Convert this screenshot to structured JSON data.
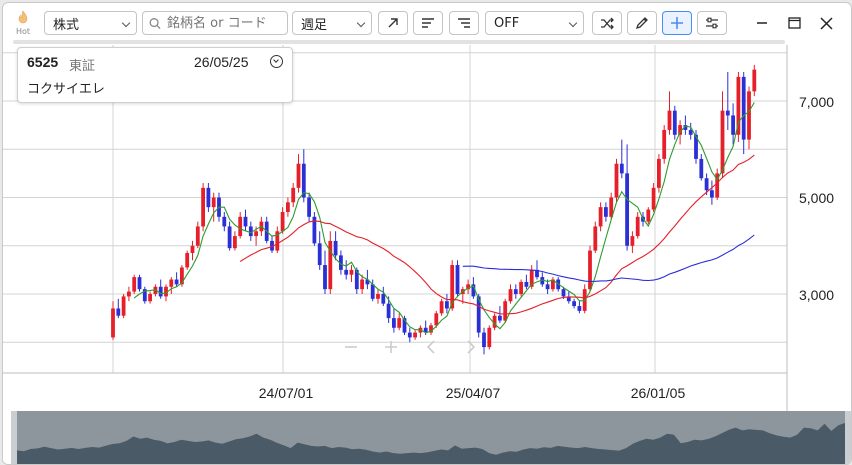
{
  "toolbar": {
    "hot_label": "Hot",
    "type_select": "株式",
    "search_placeholder": "銘柄名 or コード",
    "period_select": "週足",
    "overlay_select": "OFF"
  },
  "info": {
    "code": "6525",
    "market": "東証",
    "date": "26/05/25",
    "name": "コクサイエレ"
  },
  "axis": {
    "y_ticks": [
      "7,000",
      "5,000",
      "3,000"
    ],
    "x_ticks": [
      "24/07/01",
      "25/04/07",
      "26/01/05"
    ]
  },
  "colors": {
    "up": "#e5202a",
    "down": "#2a2fd6",
    "ma_short": "#2e9b2e",
    "ma_mid": "#e5202a",
    "ma_long": "#2a2fd6",
    "accent": "#4a8df0"
  },
  "chart_data": {
    "type": "candlestick",
    "y_range": [
      1400,
      8000
    ],
    "candles": [
      [
        2100,
        2850,
        2050,
        2700
      ],
      [
        2700,
        2900,
        2500,
        2550
      ],
      [
        2550,
        3000,
        2500,
        2950
      ],
      [
        2950,
        3150,
        2850,
        3050
      ],
      [
        3050,
        3400,
        3000,
        3350
      ],
      [
        3350,
        3400,
        3050,
        3100
      ],
      [
        3100,
        3150,
        2800,
        2850
      ],
      [
        2850,
        3050,
        2800,
        3000
      ],
      [
        3000,
        3200,
        2950,
        3150
      ],
      [
        3150,
        3300,
        2900,
        2950
      ],
      [
        2950,
        3200,
        2850,
        3150
      ],
      [
        3150,
        3350,
        3000,
        3300
      ],
      [
        3300,
        3450,
        3150,
        3200
      ],
      [
        3200,
        3600,
        3150,
        3550
      ],
      [
        3550,
        3900,
        3500,
        3850
      ],
      [
        3850,
        4100,
        3700,
        4000
      ],
      [
        4000,
        4500,
        3950,
        4400
      ],
      [
        4400,
        5300,
        4300,
        5200
      ],
      [
        5200,
        5300,
        4700,
        4800
      ],
      [
        4800,
        5100,
        4500,
        5000
      ],
      [
        5000,
        5100,
        4500,
        4600
      ],
      [
        4600,
        4700,
        4300,
        4400
      ],
      [
        4400,
        4500,
        3900,
        3950
      ],
      [
        3950,
        4300,
        3900,
        4200
      ],
      [
        4200,
        4700,
        4150,
        4600
      ],
      [
        4600,
        4750,
        4300,
        4400
      ],
      [
        4400,
        4500,
        4100,
        4200
      ],
      [
        4200,
        4400,
        4000,
        4300
      ],
      [
        4300,
        4600,
        4200,
        4500
      ],
      [
        4500,
        4600,
        4050,
        4100
      ],
      [
        4100,
        4200,
        3850,
        3900
      ],
      [
        3900,
        4400,
        3850,
        4300
      ],
      [
        4300,
        4800,
        4250,
        4700
      ],
      [
        4700,
        5000,
        4600,
        4900
      ],
      [
        4900,
        5300,
        4800,
        5200
      ],
      [
        5200,
        5900,
        5100,
        5700
      ],
      [
        5700,
        6000,
        4900,
        5000
      ],
      [
        5000,
        5100,
        4500,
        4600
      ],
      [
        4600,
        4700,
        4000,
        4050
      ],
      [
        4050,
        4300,
        3500,
        3600
      ],
      [
        3600,
        3900,
        3000,
        3100
      ],
      [
        3100,
        4300,
        3000,
        4100
      ],
      [
        4100,
        4300,
        3700,
        3800
      ],
      [
        3800,
        3900,
        3400,
        3500
      ],
      [
        3500,
        3700,
        3300,
        3400
      ],
      [
        3400,
        3600,
        3250,
        3500
      ],
      [
        3500,
        3550,
        3000,
        3100
      ],
      [
        3100,
        3400,
        3000,
        3300
      ],
      [
        3300,
        3500,
        3100,
        3200
      ],
      [
        3200,
        3300,
        2850,
        2900
      ],
      [
        2900,
        3100,
        2800,
        3000
      ],
      [
        3000,
        3150,
        2750,
        2800
      ],
      [
        2800,
        2950,
        2400,
        2500
      ],
      [
        2500,
        2700,
        2200,
        2300
      ],
      [
        2300,
        2600,
        2250,
        2500
      ],
      [
        2500,
        2550,
        2150,
        2200
      ],
      [
        2200,
        2300,
        2000,
        2100
      ],
      [
        2100,
        2250,
        2050,
        2200
      ],
      [
        2200,
        2350,
        2100,
        2300
      ],
      [
        2300,
        2450,
        2150,
        2200
      ],
      [
        2200,
        2400,
        2150,
        2350
      ],
      [
        2350,
        2650,
        2300,
        2600
      ],
      [
        2600,
        2900,
        2550,
        2850
      ],
      [
        2850,
        3000,
        2600,
        2700
      ],
      [
        2700,
        3700,
        2650,
        3600
      ],
      [
        3600,
        3700,
        2950,
        3000
      ],
      [
        3000,
        3150,
        2800,
        3100
      ],
      [
        3100,
        3300,
        3000,
        3200
      ],
      [
        3200,
        3350,
        2900,
        2950
      ],
      [
        2950,
        3000,
        2100,
        2200
      ],
      [
        2200,
        2300,
        1750,
        1900
      ],
      [
        1900,
        2350,
        1850,
        2300
      ],
      [
        2300,
        2600,
        2250,
        2550
      ],
      [
        2550,
        2750,
        2400,
        2450
      ],
      [
        2450,
        2900,
        2400,
        2850
      ],
      [
        2850,
        3200,
        2800,
        3100
      ],
      [
        3100,
        3200,
        2900,
        3000
      ],
      [
        3000,
        3300,
        2950,
        3250
      ],
      [
        3250,
        3400,
        3100,
        3150
      ],
      [
        3150,
        3600,
        3100,
        3500
      ],
      [
        3500,
        3700,
        3300,
        3350
      ],
      [
        3350,
        3450,
        3150,
        3200
      ],
      [
        3200,
        3300,
        3000,
        3100
      ],
      [
        3100,
        3350,
        3050,
        3300
      ],
      [
        3300,
        3350,
        3050,
        3100
      ],
      [
        3100,
        3150,
        2900,
        2950
      ],
      [
        2950,
        3050,
        2800,
        2850
      ],
      [
        2850,
        2900,
        2700,
        2750
      ],
      [
        2750,
        2850,
        2600,
        2650
      ],
      [
        2650,
        3200,
        2600,
        3100
      ],
      [
        3100,
        4000,
        3050,
        3900
      ],
      [
        3900,
        4500,
        3850,
        4400
      ],
      [
        4400,
        4900,
        4300,
        4800
      ],
      [
        4800,
        4900,
        4500,
        4600
      ],
      [
        4600,
        5100,
        4550,
        5000
      ],
      [
        5000,
        5800,
        4900,
        5700
      ],
      [
        5700,
        6200,
        5400,
        5500
      ],
      [
        5500,
        6100,
        3900,
        4000
      ],
      [
        4000,
        4300,
        3850,
        4200
      ],
      [
        4200,
        4700,
        4150,
        4600
      ],
      [
        4600,
        4700,
        4400,
        4500
      ],
      [
        4500,
        4800,
        4450,
        4750
      ],
      [
        4750,
        5300,
        4700,
        5200
      ],
      [
        5200,
        5900,
        5100,
        5800
      ],
      [
        5800,
        6500,
        5700,
        6400
      ],
      [
        6400,
        7200,
        6300,
        6800
      ],
      [
        6800,
        6900,
        6200,
        6300
      ],
      [
        6300,
        6600,
        6100,
        6500
      ],
      [
        6500,
        6700,
        6300,
        6400
      ],
      [
        6400,
        6550,
        6200,
        6300
      ],
      [
        6300,
        6400,
        5700,
        5800
      ],
      [
        5800,
        5900,
        5350,
        5400
      ],
      [
        5400,
        5500,
        5050,
        5150
      ],
      [
        5150,
        5350,
        4850,
        5000
      ],
      [
        5000,
        5600,
        4950,
        5500
      ],
      [
        5500,
        7200,
        5400,
        6800
      ],
      [
        6800,
        7600,
        6400,
        6700
      ],
      [
        6700,
        6950,
        6100,
        6300
      ],
      [
        6300,
        7600,
        6150,
        7500
      ],
      [
        7500,
        7600,
        5900,
        6200
      ],
      [
        6200,
        7300,
        6000,
        7200
      ],
      [
        7200,
        7750,
        7100,
        7650
      ]
    ]
  }
}
